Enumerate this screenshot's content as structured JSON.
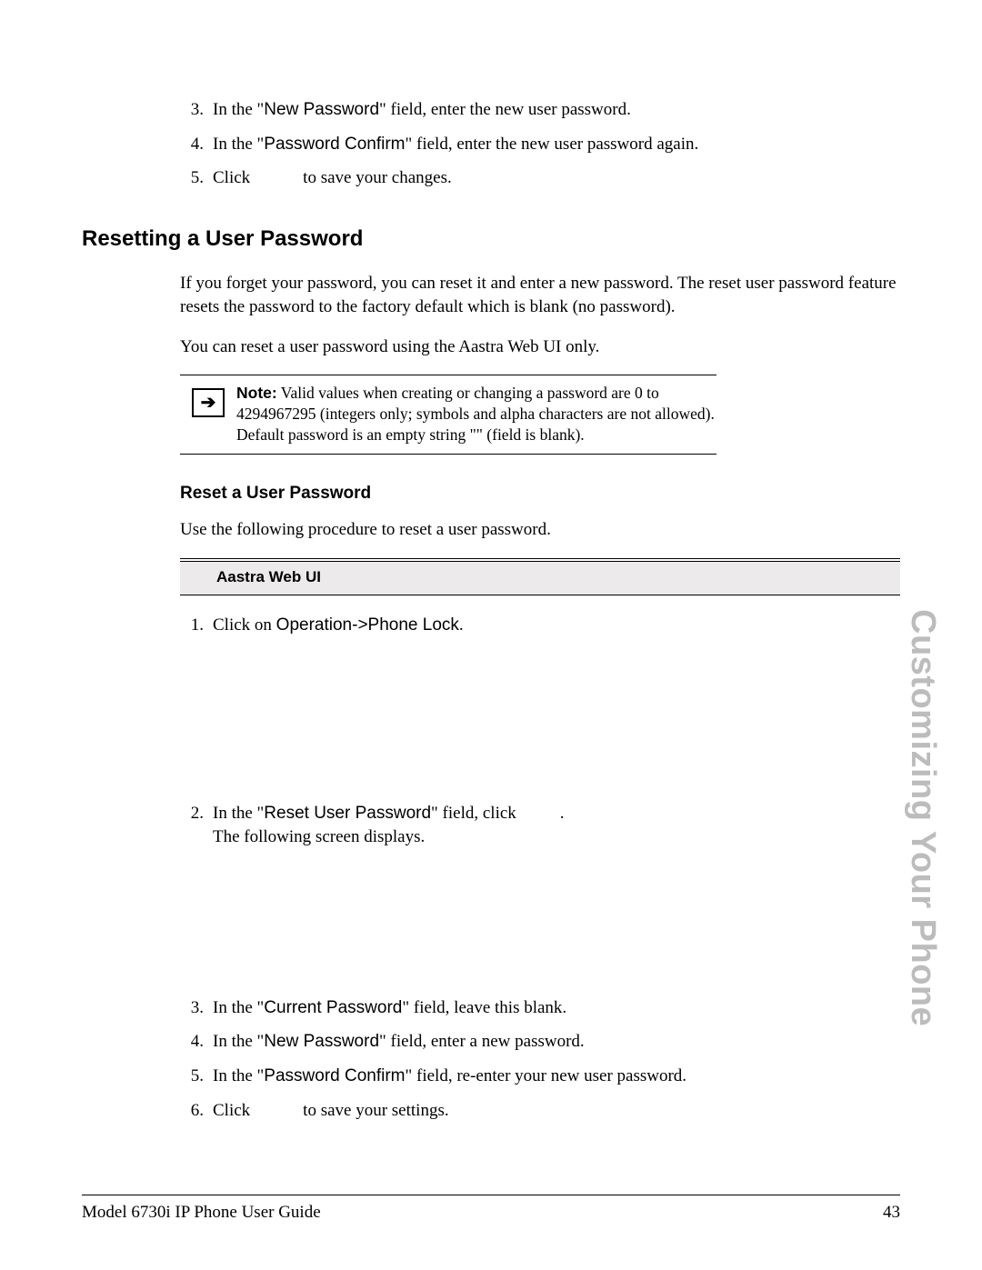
{
  "side_title": "Customizing Your Phone",
  "footer": {
    "left": "Model 6730i IP Phone User Guide",
    "right": "43"
  },
  "top_steps": [
    {
      "n": "3.",
      "pre": "In the \"",
      "field": "New Password",
      "post": "\" field, enter the new user password."
    },
    {
      "n": "4.",
      "pre": "In the \"",
      "field": "Password Confirm",
      "post": "\" field, enter the new user password again."
    },
    {
      "n": "5.",
      "pre": "Click",
      "field": "",
      "post": "to save your changes."
    }
  ],
  "section_heading": "Resetting a User Password",
  "para1": "If you forget your password, you can reset it and enter a new password. The reset user password feature resets the password to the factory default which is blank (no password).",
  "para2": "You can reset a user password using the Aastra Web UI only.",
  "note": {
    "label": "Note:",
    "text": " Valid values when creating or changing a password are 0 to 4294967295 (integers only; symbols and alpha characters are not allowed). Default password is an empty string \"\" (field is blank)."
  },
  "subhead": "Reset a User Password",
  "subpara": "Use the following procedure to reset a user password.",
  "proc_label": "Aastra Web UI",
  "step1": {
    "n": "1.",
    "pre": "Click on ",
    "field": "Operation->Phone Lock",
    "post": "."
  },
  "step2a": {
    "n": "2.",
    "pre": "In the \"",
    "field": "Reset User Password",
    "post": "\" field, click"
  },
  "step2b": "The following screen displays.",
  "bottom_steps": [
    {
      "n": "3.",
      "pre": "In the \"",
      "field": "Current Password",
      "post": "\" field, leave this blank."
    },
    {
      "n": "4.",
      "pre": "In the \"",
      "field": "New Password",
      "post": "\" field, enter a new password."
    },
    {
      "n": "5.",
      "pre": "In the \"",
      "field": "Password Confirm",
      "post": "\" field, re-enter your new user password."
    },
    {
      "n": "6.",
      "pre": "Click",
      "field": "",
      "post": "to save your settings."
    }
  ]
}
